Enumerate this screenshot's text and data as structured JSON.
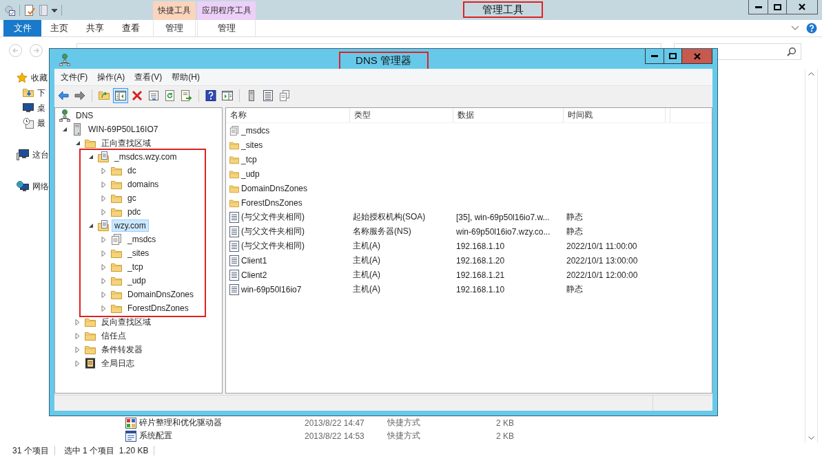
{
  "explorer": {
    "title": "管理工具",
    "title_annotated": true,
    "context_groups": [
      {
        "title": "快捷工具",
        "tab": "管理",
        "color": "#fbd4bd"
      },
      {
        "title": "应用程序工具",
        "tab": "管理",
        "color": "#ecd0f8"
      }
    ],
    "ribbon_tabs": [
      {
        "label": "文件",
        "selected": true
      },
      {
        "label": "主页",
        "selected": false
      },
      {
        "label": "共享",
        "selected": false
      },
      {
        "label": "查看",
        "selected": false
      }
    ],
    "sidebar": [
      {
        "label": "收藏",
        "kind": "star",
        "children": [
          {
            "label": "下",
            "kind": "downloads"
          },
          {
            "label": "桌",
            "kind": "desktop"
          },
          {
            "label": "最",
            "kind": "recent"
          }
        ]
      },
      {
        "label": "这台",
        "kind": "computer"
      },
      {
        "label": "网络",
        "kind": "network"
      }
    ],
    "files": [
      {
        "kind": "defrag",
        "name": "碎片整理和优化驱动器",
        "date": "2013/8/22 14:47",
        "type": "快捷方式",
        "size": "2 KB"
      },
      {
        "kind": "config",
        "name": "系统配置",
        "date": "2013/8/22 14:53",
        "type": "快捷方式",
        "size": "2 KB"
      }
    ],
    "status_bar": {
      "item_count": "31 个项目",
      "selection": "选中 1 个项目",
      "selection_size": "1.20 KB"
    }
  },
  "dns_manager": {
    "title": "DNS 管理器",
    "title_annotated": true,
    "menu": [
      "文件(F)",
      "操作(A)",
      "查看(V)",
      "帮助(H)"
    ],
    "toolbar": [
      [
        {
          "kind": "back",
          "pressed": false
        },
        {
          "kind": "forward",
          "pressed": false
        }
      ],
      [
        {
          "kind": "up",
          "pressed": false
        },
        {
          "kind": "tree",
          "pressed": true
        },
        {
          "kind": "delete",
          "pressed": false
        },
        {
          "kind": "properties",
          "pressed": false
        },
        {
          "kind": "refresh",
          "pressed": false
        },
        {
          "kind": "export",
          "pressed": false
        }
      ],
      [
        {
          "kind": "help",
          "pressed": false
        },
        {
          "kind": "action",
          "pressed": false
        }
      ],
      [
        {
          "kind": "server",
          "pressed": false
        },
        {
          "kind": "list",
          "pressed": false
        },
        {
          "kind": "copy",
          "pressed": false
        }
      ]
    ],
    "tree": [
      {
        "label": "DNS",
        "kind": "dns",
        "selected": false,
        "children": [
          {
            "label": "WIN-69P50L16IO7",
            "kind": "server",
            "expanded": true,
            "selected": false,
            "children": [
              {
                "label": "正向查找区域",
                "kind": "folder",
                "expanded": true,
                "selected": false,
                "outlined_children": true,
                "children": [
                  {
                    "label": "_msdcs.wzy.com",
                    "kind": "zone",
                    "expanded": true,
                    "selected": false,
                    "children": [
                      {
                        "label": "dc",
                        "kind": "folder",
                        "expanded": false,
                        "selected": false
                      },
                      {
                        "label": "domains",
                        "kind": "folder",
                        "expanded": false,
                        "selected": false
                      },
                      {
                        "label": "gc",
                        "kind": "folder",
                        "expanded": false,
                        "selected": false
                      },
                      {
                        "label": "pdc",
                        "kind": "folder",
                        "expanded": false,
                        "selected": false
                      }
                    ]
                  },
                  {
                    "label": "wzy.com",
                    "kind": "zone",
                    "expanded": true,
                    "selected": true,
                    "children": [
                      {
                        "label": "_msdcs",
                        "kind": "delegation",
                        "expanded": false,
                        "selected": false
                      },
                      {
                        "label": "_sites",
                        "kind": "folder",
                        "expanded": false,
                        "selected": false
                      },
                      {
                        "label": "_tcp",
                        "kind": "folder",
                        "expanded": false,
                        "selected": false
                      },
                      {
                        "label": "_udp",
                        "kind": "folder",
                        "expanded": false,
                        "selected": false
                      },
                      {
                        "label": "DomainDnsZones",
                        "kind": "folder",
                        "expanded": false,
                        "selected": false
                      },
                      {
                        "label": "ForestDnsZones",
                        "kind": "folder",
                        "expanded": false,
                        "selected": false
                      }
                    ]
                  }
                ]
              },
              {
                "label": "反向查找区域",
                "kind": "folder",
                "expanded": false,
                "selected": false
              },
              {
                "label": "信任点",
                "kind": "folder",
                "expanded": false,
                "selected": false
              },
              {
                "label": "条件转发器",
                "kind": "folder",
                "expanded": false,
                "selected": false
              },
              {
                "label": "全局日志",
                "kind": "log",
                "expanded": false,
                "selected": false
              }
            ]
          }
        ]
      }
    ],
    "list": {
      "columns": [
        "名称",
        "类型",
        "数据",
        "时间戳"
      ],
      "rows": [
        {
          "kind": "delegation",
          "name": "_msdcs"
        },
        {
          "kind": "folder",
          "name": "_sites"
        },
        {
          "kind": "folder",
          "name": "_tcp"
        },
        {
          "kind": "folder",
          "name": "_udp"
        },
        {
          "kind": "folder",
          "name": "DomainDnsZones"
        },
        {
          "kind": "folder",
          "name": "ForestDnsZones"
        },
        {
          "kind": "record",
          "name": "(与父文件夹相同)",
          "type": "起始授权机构(SOA)",
          "data": "[35], win-69p50l16io7.w...",
          "timestamp": "静态"
        },
        {
          "kind": "record",
          "name": "(与父文件夹相同)",
          "type": "名称服务器(NS)",
          "data": "win-69p50l16io7.wzy.co...",
          "timestamp": "静态"
        },
        {
          "kind": "record",
          "name": "(与父文件夹相同)",
          "type": "主机(A)",
          "data": "192.168.1.10",
          "timestamp": "2022/10/1 11:00:00"
        },
        {
          "kind": "record",
          "name": "Client1",
          "type": "主机(A)",
          "data": "192.168.1.20",
          "timestamp": "2022/10/1 13:00:00"
        },
        {
          "kind": "record",
          "name": "Client2",
          "type": "主机(A)",
          "data": "192.168.1.21",
          "timestamp": "2022/10/1 12:00:00"
        },
        {
          "kind": "record",
          "name": "win-69p50l16io7",
          "type": "主机(A)",
          "data": "192.168.1.10",
          "timestamp": "静态"
        }
      ]
    }
  }
}
